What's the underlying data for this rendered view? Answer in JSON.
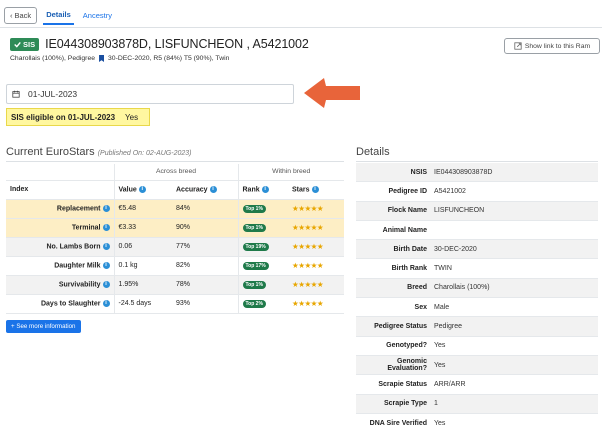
{
  "nav": {
    "back_label": "Back",
    "tabs": [
      {
        "label": "Details",
        "active": true
      },
      {
        "label": "Ancestry",
        "active": false
      }
    ]
  },
  "header": {
    "badge": "SIS",
    "title": "IE044308903878D, LISFUNCHEON , A5421002",
    "sub_breed": "Charollais (100%), Pedigree",
    "sub_info": "30-DEC-2020, R5 (84%) T5 (90%), Twin",
    "ram_button": "Show link to this Ram"
  },
  "date": {
    "value": "01-JUL-2023"
  },
  "eligibility": {
    "label": "SIS eligible on 01-JUL-2023",
    "value": "Yes"
  },
  "eurostars": {
    "title": "Current EuroStars",
    "published": "(Published On: 02-AUG-2023)",
    "group_across": "Across breed",
    "group_within": "Within breed",
    "columns": {
      "index": "Index",
      "value": "Value",
      "accuracy": "Accuracy",
      "rank": "Rank",
      "stars": "Stars"
    },
    "rows": [
      {
        "index": "Replacement",
        "value": "€5.48",
        "accuracy": "84%",
        "rank": "Top 1%",
        "stars": "★★★★★"
      },
      {
        "index": "Terminal",
        "value": "€3.33",
        "accuracy": "90%",
        "rank": "Top 1%",
        "stars": "★★★★★"
      },
      {
        "index": "No. Lambs Born",
        "value": "0.06",
        "accuracy": "77%",
        "rank": "Top 19%",
        "stars": "★★★★★"
      },
      {
        "index": "Daughter Milk",
        "value": "0.1 kg",
        "accuracy": "82%",
        "rank": "Top 17%",
        "stars": "★★★★★"
      },
      {
        "index": "Survivability",
        "value": "1.95%",
        "accuracy": "78%",
        "rank": "Top 1%",
        "stars": "★★★★★"
      },
      {
        "index": "Days to Slaughter",
        "value": "-24.5 days",
        "accuracy": "93%",
        "rank": "Top 2%",
        "stars": "★★★★★"
      }
    ],
    "more_button": "+ See more information"
  },
  "details": {
    "title": "Details",
    "rows": [
      {
        "label": "NSIS",
        "value": "IE044308903878D"
      },
      {
        "label": "Pedigree ID",
        "value": "A5421002"
      },
      {
        "label": "Flock Name",
        "value": "LISFUNCHEON"
      },
      {
        "label": "Animal Name",
        "value": ""
      },
      {
        "label": "Birth Date",
        "value": "30-DEC-2020"
      },
      {
        "label": "Birth Rank",
        "value": "TWIN"
      },
      {
        "label": "Breed",
        "value": "Charollais (100%)"
      },
      {
        "label": "Sex",
        "value": "Male"
      },
      {
        "label": "Pedigree Status",
        "value": "Pedigree"
      },
      {
        "label": "Genotyped?",
        "value": "Yes"
      },
      {
        "label": "Genomic Evaluation?",
        "value": "Yes"
      },
      {
        "label": "Scrapie Status",
        "value": "ARR/ARR"
      },
      {
        "label": "Scrapie Type",
        "value": "1"
      },
      {
        "label": "DNA Sire Verified",
        "value": "Yes"
      }
    ]
  },
  "colors": {
    "accent": "#1a73e8",
    "sis_green": "#2e8b57",
    "highlight_yellow": "#fff7a0",
    "row_highlight": "#fdeec5",
    "arrow": "#e8643a",
    "star": "#e8a600"
  },
  "icons": {
    "back": "chevron-left-icon",
    "check": "check-icon",
    "calendar": "calendar-icon",
    "bookmark": "bookmark-icon",
    "link": "link-icon",
    "info": "info-icon",
    "arrow": "arrow-left-icon"
  }
}
